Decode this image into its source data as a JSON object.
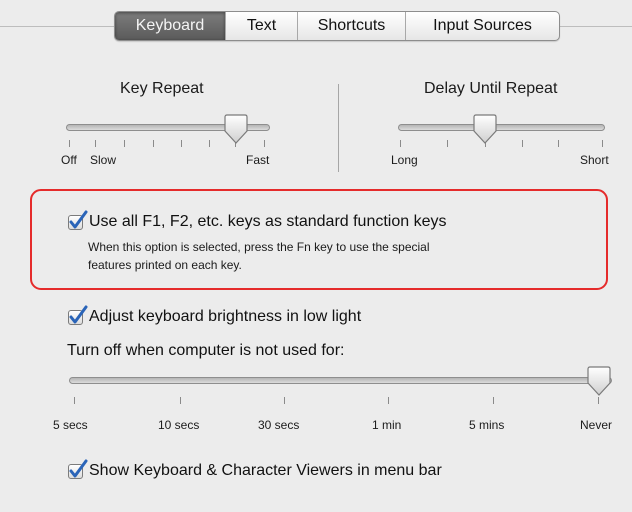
{
  "tabs": [
    {
      "label": "Keyboard",
      "active": true
    },
    {
      "label": "Text",
      "active": false
    },
    {
      "label": "Shortcuts",
      "active": false
    },
    {
      "label": "Input Sources",
      "active": false
    }
  ],
  "key_repeat": {
    "title": "Key Repeat",
    "labels": {
      "left": "Off",
      "left2": "Slow",
      "right": "Fast"
    },
    "value_fraction": 0.82
  },
  "delay_until_repeat": {
    "title": "Delay Until Repeat",
    "labels": {
      "left": "Long",
      "right": "Short"
    },
    "value_fraction": 0.42
  },
  "function_keys": {
    "checked": true,
    "label": "Use all F1, F2, etc. keys as standard function keys",
    "description_line1": "When this option is selected, press the Fn key to use the special",
    "description_line2": "features printed on each key."
  },
  "brightness": {
    "checked": true,
    "label": "Adjust keyboard brightness in low light"
  },
  "turn_off": {
    "label": "Turn off when computer is not used for:",
    "labels": [
      "5 secs",
      "10 secs",
      "30 secs",
      "1 min",
      "5 mins",
      "Never"
    ],
    "selected": "Never"
  },
  "viewers": {
    "checked": true,
    "label": "Show Keyboard & Character Viewers in menu bar"
  },
  "colors": {
    "highlight_border": "#e52b2b",
    "check_mark": "#2a64b8",
    "active_tab": "#6a6a6a"
  }
}
